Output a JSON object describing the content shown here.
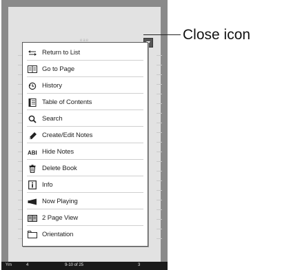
{
  "callout": {
    "text": "Close icon"
  },
  "screen": {
    "title": "eae"
  },
  "status_bar": {
    "left": "Ym",
    "mid": "4",
    "page": "9-10 of 25",
    "right": "3"
  },
  "menu": {
    "items": [
      {
        "label": "Return to List",
        "icon": "return-arrow-icon"
      },
      {
        "label": "Go to Page",
        "icon": "book-icon"
      },
      {
        "label": "History",
        "icon": "history-icon"
      },
      {
        "label": "Table of Contents",
        "icon": "contents-icon"
      },
      {
        "label": "Search",
        "icon": "search-icon"
      },
      {
        "label": "Create/Edit Notes",
        "icon": "pen-icon"
      },
      {
        "label": "Hide Notes",
        "icon": "abc-icon"
      },
      {
        "label": "Delete Book",
        "icon": "trash-icon"
      },
      {
        "label": "Info",
        "icon": "info-icon"
      },
      {
        "label": "Now Playing",
        "icon": "play-icon"
      },
      {
        "label": "2 Page View",
        "icon": "two-page-icon"
      },
      {
        "label": "Orientation",
        "icon": "orientation-icon"
      }
    ]
  },
  "colors": {
    "menu_bg": "#ffffff",
    "device_frame": "#8a8a8a",
    "screen_bg": "#e2e2e2"
  }
}
